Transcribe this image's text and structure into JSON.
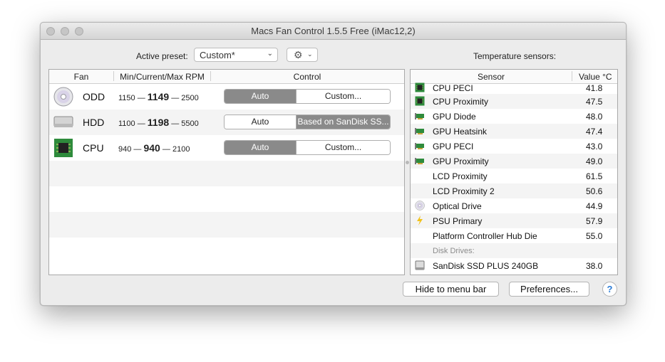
{
  "window": {
    "title": "Macs Fan Control 1.5.5 Free (iMac12,2)"
  },
  "preset": {
    "label": "Active preset:",
    "value": "Custom*"
  },
  "sensors_title": "Temperature sensors:",
  "fans_table": {
    "headers": [
      "Fan",
      "Min/Current/Max RPM",
      "Control"
    ],
    "rows": [
      {
        "name": "ODD",
        "icon": "optical-drive-icon",
        "min": "1150",
        "current": "1149",
        "max": "2500",
        "sep": "—",
        "left": "Auto",
        "right": "Custom...",
        "active": "left"
      },
      {
        "name": "HDD",
        "icon": "hard-drive-icon",
        "min": "1100",
        "current": "1198",
        "max": "5500",
        "sep": "—",
        "left": "Auto",
        "right": "Based on SanDisk SS...",
        "active": "right"
      },
      {
        "name": "CPU",
        "icon": "cpu-chip-icon",
        "min": "940",
        "current": "940",
        "max": "2100",
        "sep": "—",
        "left": "Auto",
        "right": "Custom...",
        "active": "left"
      }
    ]
  },
  "sensors_table": {
    "headers": [
      "Sensor",
      "Value °C"
    ],
    "rows": [
      {
        "name": "CPU PECI",
        "value": "41.8",
        "icon": "cpu-chip-icon"
      },
      {
        "name": "CPU Proximity",
        "value": "47.5",
        "icon": "cpu-chip-icon"
      },
      {
        "name": "GPU Diode",
        "value": "48.0",
        "icon": "gpu-card-icon"
      },
      {
        "name": "GPU Heatsink",
        "value": "47.4",
        "icon": "gpu-card-icon"
      },
      {
        "name": "GPU PECI",
        "value": "43.0",
        "icon": "gpu-card-icon"
      },
      {
        "name": "GPU Proximity",
        "value": "49.0",
        "icon": "gpu-card-icon"
      },
      {
        "name": "LCD Proximity",
        "value": "61.5",
        "icon": ""
      },
      {
        "name": "LCD Proximity 2",
        "value": "50.6",
        "icon": ""
      },
      {
        "name": "Optical Drive",
        "value": "44.9",
        "icon": "optical-drive-icon"
      },
      {
        "name": "PSU Primary",
        "value": "57.9",
        "icon": "lightning-icon"
      },
      {
        "name": "Platform Controller Hub Die",
        "value": "55.0",
        "icon": ""
      },
      {
        "group": "Disk Drives:"
      },
      {
        "name": "SanDisk SSD PLUS 240GB",
        "value": "38.0",
        "icon": "ssd-icon"
      }
    ]
  },
  "buttons": {
    "hide": "Hide to menu bar",
    "prefs": "Preferences...",
    "help": "?"
  },
  "icons": {
    "gear": "gear-icon",
    "chevron": "chevron-down-icon"
  }
}
